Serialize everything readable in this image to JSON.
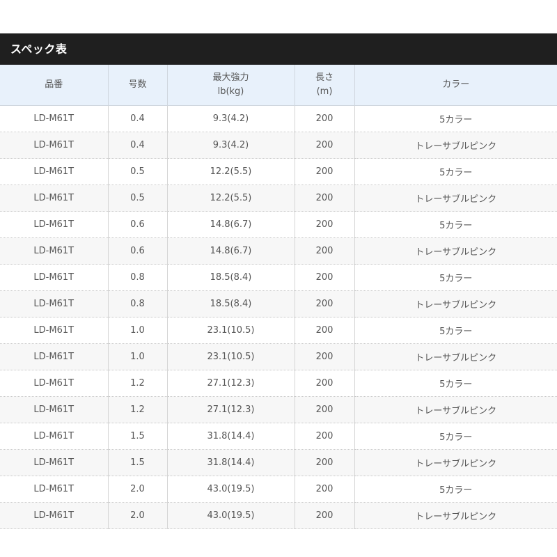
{
  "section": {
    "title": "スペック表"
  },
  "table": {
    "headers": {
      "part_number": "品番",
      "number": "号数",
      "strength_line1": "最大強力",
      "strength_line2": "lb(kg)",
      "length_line1": "長さ",
      "length_line2": "(m)",
      "color": "カラー"
    },
    "rows": [
      {
        "part_number": "LD-M61T",
        "number": "0.4",
        "strength": "9.3(4.2)",
        "length": "200",
        "color": "5カラー"
      },
      {
        "part_number": "LD-M61T",
        "number": "0.4",
        "strength": "9.3(4.2)",
        "length": "200",
        "color": "トレーサブルピンク"
      },
      {
        "part_number": "LD-M61T",
        "number": "0.5",
        "strength": "12.2(5.5)",
        "length": "200",
        "color": "5カラー"
      },
      {
        "part_number": "LD-M61T",
        "number": "0.5",
        "strength": "12.2(5.5)",
        "length": "200",
        "color": "トレーサブルピンク"
      },
      {
        "part_number": "LD-M61T",
        "number": "0.6",
        "strength": "14.8(6.7)",
        "length": "200",
        "color": "5カラー"
      },
      {
        "part_number": "LD-M61T",
        "number": "0.6",
        "strength": "14.8(6.7)",
        "length": "200",
        "color": "トレーサブルピンク"
      },
      {
        "part_number": "LD-M61T",
        "number": "0.8",
        "strength": "18.5(8.4)",
        "length": "200",
        "color": "5カラー"
      },
      {
        "part_number": "LD-M61T",
        "number": "0.8",
        "strength": "18.5(8.4)",
        "length": "200",
        "color": "トレーサブルピンク"
      },
      {
        "part_number": "LD-M61T",
        "number": "1.0",
        "strength": "23.1(10.5)",
        "length": "200",
        "color": "5カラー"
      },
      {
        "part_number": "LD-M61T",
        "number": "1.0",
        "strength": "23.1(10.5)",
        "length": "200",
        "color": "トレーサブルピンク"
      },
      {
        "part_number": "LD-M61T",
        "number": "1.2",
        "strength": "27.1(12.3)",
        "length": "200",
        "color": "5カラー"
      },
      {
        "part_number": "LD-M61T",
        "number": "1.2",
        "strength": "27.1(12.3)",
        "length": "200",
        "color": "トレーサブルピンク"
      },
      {
        "part_number": "LD-M61T",
        "number": "1.5",
        "strength": "31.8(14.4)",
        "length": "200",
        "color": "5カラー"
      },
      {
        "part_number": "LD-M61T",
        "number": "1.5",
        "strength": "31.8(14.4)",
        "length": "200",
        "color": "トレーサブルピンク"
      },
      {
        "part_number": "LD-M61T",
        "number": "2.0",
        "strength": "43.0(19.5)",
        "length": "200",
        "color": "5カラー"
      },
      {
        "part_number": "LD-M61T",
        "number": "2.0",
        "strength": "43.0(19.5)",
        "length": "200",
        "color": "トレーサブルピンク"
      }
    ]
  },
  "colors": {
    "header_bar": "#1f1f1f",
    "column_header_bg": "#e8f1fb",
    "alt_row_bg": "#f7f7f7",
    "text": "#555555"
  }
}
